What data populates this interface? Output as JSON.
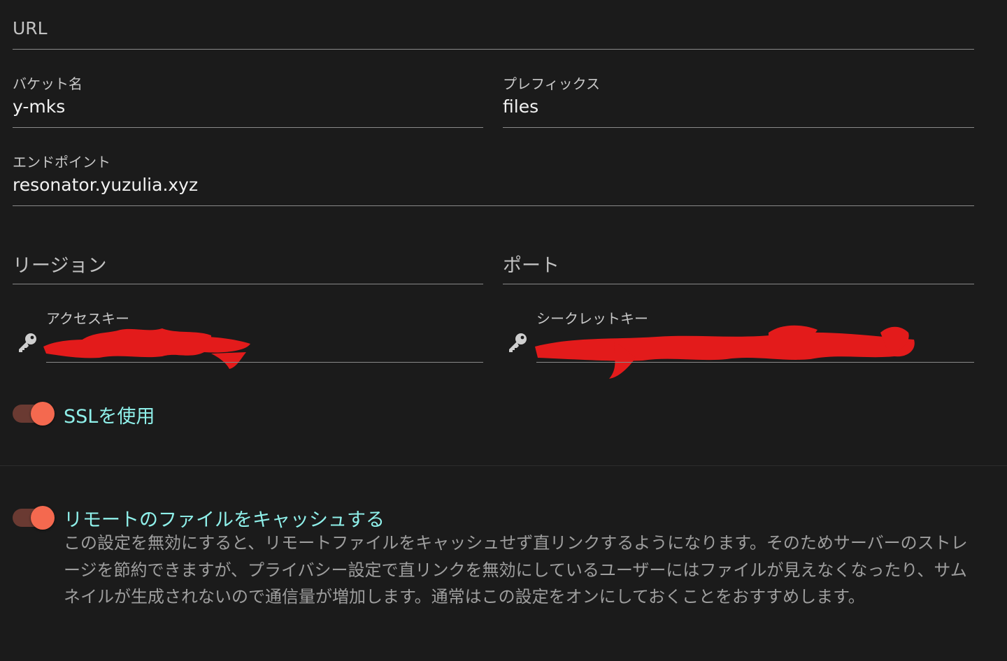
{
  "url_field": {
    "label": "URL",
    "value": ""
  },
  "bucket_field": {
    "label": "バケット名",
    "value": "y-mks"
  },
  "prefix_field": {
    "label": "プレフィックス",
    "value": "files"
  },
  "endpoint_field": {
    "label": "エンドポイント",
    "value": "resonator.yuzulia.xyz"
  },
  "region_field": {
    "label": "リージョン",
    "value": ""
  },
  "port_field": {
    "label": "ポート",
    "value": ""
  },
  "access_key_field": {
    "label": "アクセスキー",
    "icon": "key-icon",
    "value_redacted": true
  },
  "secret_key_field": {
    "label": "シークレットキー",
    "icon": "key-icon",
    "value_redacted": true
  },
  "ssl_toggle": {
    "label": "SSLを使用",
    "checked": true
  },
  "cache_toggle": {
    "label": "リモートのファイルをキャッシュする",
    "checked": true,
    "description": "この設定を無効にすると、リモートファイルをキャッシュせず直リンクするようになります。そのためサーバーのストレージを節約できますが、プライバシー設定で直リンクを無効にしているユーザーにはファイルが見えなくなったり、サムネイルが生成されないので通信量が増加します。通常はこの設定をオンにしておくことをおすすめします。"
  },
  "colors": {
    "background": "#1b1b1b",
    "accent": "#f4694f",
    "toggle_track": "#6a3a32",
    "toggle_label": "#8ff0ea",
    "redaction": "#e31b1b"
  }
}
